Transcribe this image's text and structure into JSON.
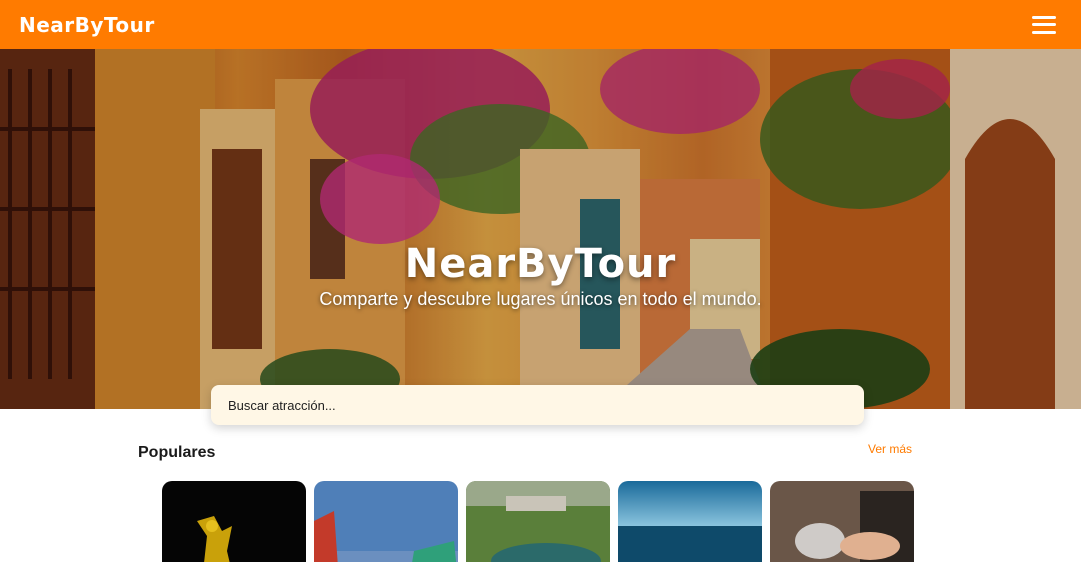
{
  "header": {
    "logo": "NearByTour",
    "menu_icon": "hamburger-menu-icon"
  },
  "hero": {
    "title": "NearByTour",
    "subtitle": "Comparte y descubre lugares únicos en todo el mundo."
  },
  "search": {
    "placeholder": "Buscar atracción..."
  },
  "popular": {
    "title": "Populares",
    "see_more": "Ver más",
    "cards": [
      {
        "theme": "golden-sculpture-night"
      },
      {
        "theme": "carnival-sky"
      },
      {
        "theme": "aerial-park"
      },
      {
        "theme": "ocean-horizon"
      },
      {
        "theme": "bartender-drink"
      }
    ]
  },
  "colors": {
    "brand": "#ff7b00",
    "search_bg": "#fff7e6",
    "link": "#ff7b00"
  }
}
